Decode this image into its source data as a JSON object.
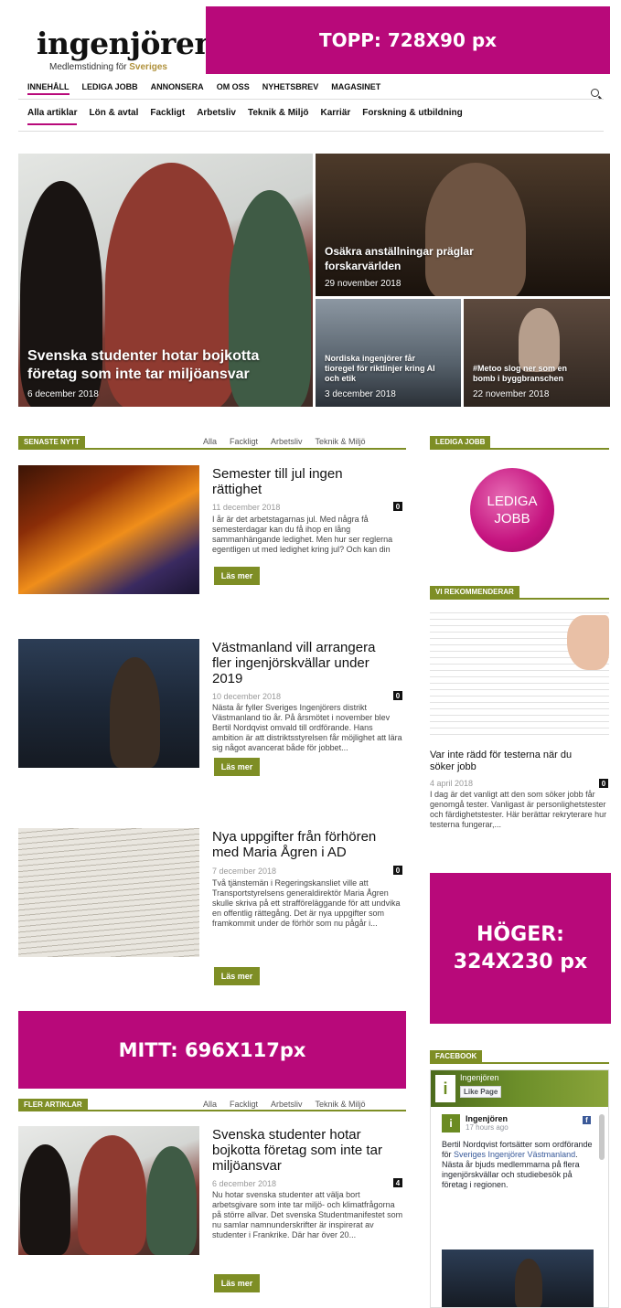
{
  "header": {
    "logo_text": "ingenjören",
    "logo_sub_prefix": "Medlemstidning för ",
    "logo_sub_accent": "Sveriges",
    "ads": {
      "top": "TOPP: 728X90 px",
      "middle": "MITT: 696X117px",
      "right_line1": "HÖGER:",
      "right_line2": "324X230 px"
    }
  },
  "nav_main": [
    "INNEHÅLL",
    "LEDIGA JOBB",
    "ANNONSERA",
    "OM OSS",
    "NYHETSBREV",
    "MAGASINET"
  ],
  "nav_sub": [
    "Alla artiklar",
    "Lön & avtal",
    "Fackligt",
    "Arbetsliv",
    "Teknik & Miljö",
    "Karriär",
    "Forskning & utbildning"
  ],
  "hero": [
    {
      "title_line1": "Svenska studenter hotar bojkotta",
      "title_line2": "företag som inte tar miljöansvar",
      "date": "6 december 2018"
    },
    {
      "title_line1": "Osäkra anställningar präglar",
      "title_line2": "forskarvärlden",
      "date": "29 november 2018"
    },
    {
      "title_line1": "Nordiska ingenjörer får",
      "title_line2": "tioregel för riktlinjer kring AI",
      "title_line3": "och etik",
      "date": "3 december 2018"
    },
    {
      "title_line1": "#Metoo slog ner som en",
      "title_line2": "bomb i byggbranschen",
      "date": "22 november 2018"
    }
  ],
  "filters": [
    "Alla",
    "Fackligt",
    "Arbetsliv",
    "Teknik & Miljö"
  ],
  "latest": {
    "label": "SENASTE NYTT",
    "articles": [
      {
        "title_line1": "Semester till jul ingen",
        "title_line2": "rättighet",
        "date": "11 december 2018",
        "comments": "0",
        "body": "I år är det arbetstagarnas jul. Med några få semesterdagar kan du få ihop en lång sammanhängande ledighet. Men hur ser reglerna egentligen ut med ledighet kring jul? Och kan din arbetsgivare vägra att..."
      },
      {
        "title_line1": "Västmanland vill arrangera",
        "title_line2": "fler ingenjörskvällar under",
        "title_line3": "2019",
        "date": "10 december 2018",
        "comments": "0",
        "body": "Nästa år fyller Sveriges Ingenjörers distrikt Västmanland tio år. På årsmötet i november blev Bertil Nordqvist omvald till ordförande. Hans ambition är att distriktsstyrelsen får möjlighet att lära sig något avancerat både för jobbet..."
      },
      {
        "title_line1": "Nya uppgifter från förhören",
        "title_line2": "med Maria Ågren i AD",
        "date": "7 december 2018",
        "comments": "0",
        "body": "Två tjänstemän i Regeringskansliet ville att Transportstyrelsens generaldirektör Maria Ågren skulle skriva på ett strafföreläggande för att undvika en offentlig rättegång. Det är nya uppgifter som framkommit under de förhör som nu pågår i..."
      }
    ],
    "more_label": "Läs mer"
  },
  "more_articles": {
    "label": "FLER ARTIKLAR",
    "article": {
      "title_line1": "Svenska studenter hotar",
      "title_line2": "bojkotta företag som inte tar",
      "title_line3": "miljöansvar",
      "date": "6 december 2018",
      "comments": "4",
      "body": "Nu hotar svenska studenter att välja bort arbetsgivare som inte tar miljö- och klimatfrågorna på större allvar. Det svenska Studentmanifestet som nu samlar namnunderskrifter är inspirerat av studenter i Frankrike. Där har över 20..."
    }
  },
  "sidebar": {
    "jobs_label": "LEDIGA JOBB",
    "jobs_logo_line1": "LEDIGA",
    "jobs_logo_line2": "JOBB",
    "recommend_label": "VI REKOMMENDERAR",
    "recommend_title_line1": "Var inte rädd för testerna när du",
    "recommend_title_line2": "söker jobb",
    "recommend_date": "4 april 2018",
    "recommend_comments": "0",
    "recommend_body": "I dag är det vanligt att den som söker jobb får genomgå tester. Vanligast är personlighetstester och färdighetstester. Här berättar rekryterare hur testerna fungerar,...",
    "facebook_label": "FACEBOOK",
    "fb_page_name": "Ingenjören",
    "fb_like": "Like Page",
    "fb_post_name": "Ingenjören",
    "fb_post_time": "17 hours ago",
    "fb_post_text_a": "Bertil Nordqvist fortsätter som ordförande för ",
    "fb_post_link": "Sveriges Ingenjörer Västmanland",
    "fb_post_text_b": ". Nästa år bjuds medlemmarna på flera ingenjörskvällar och studiebesök på företag i regionen."
  },
  "colors": {
    "ad_magenta": "#b8097a",
    "section_olive": "#7e8e25",
    "accent_gold": "#b0913b"
  }
}
